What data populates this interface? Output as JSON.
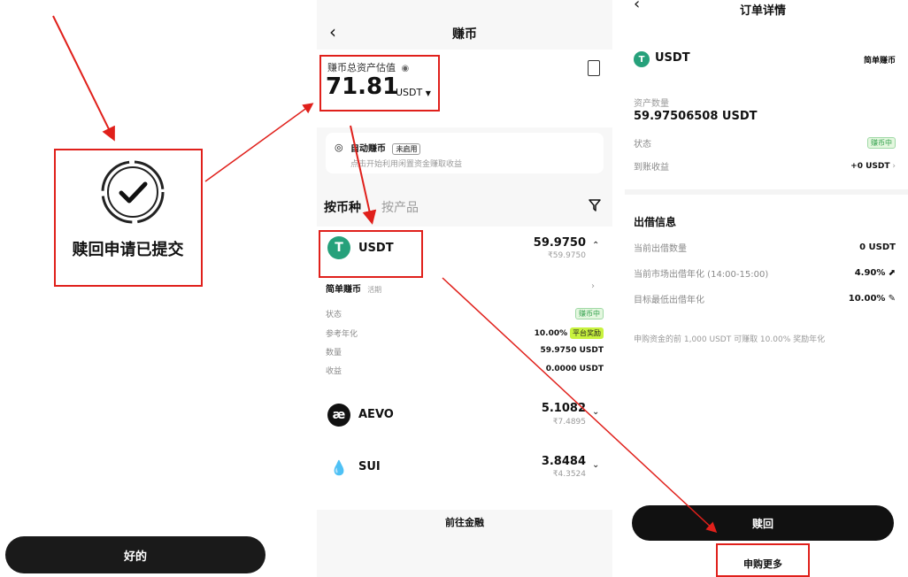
{
  "panel1": {
    "success_text": "赎回申请已提交",
    "ok_button": "好的"
  },
  "panel2": {
    "title": "赚币",
    "asset_label": "赚币总资产估值",
    "asset_value": "71.81",
    "asset_unit": "USDT",
    "auto_earn_label": "自动赚币",
    "auto_earn_tag": "未启用",
    "auto_earn_desc": "点击开始利用闲置资金赚取收益",
    "tabs": [
      "按币种",
      "按产品"
    ],
    "coins": [
      {
        "name": "USDT",
        "amount": "59.9750",
        "sub": "₹59.9750",
        "icon": "tether-icon",
        "color": "#26a17b",
        "glyph": "T"
      },
      {
        "name": "AEVO",
        "amount": "5.1082",
        "sub": "₹7.4895",
        "icon": "aevo-icon",
        "color": "#111111",
        "glyph": "æ"
      },
      {
        "name": "SUI",
        "amount": "3.8484",
        "sub": "₹4.3524",
        "icon": "sui-drop-icon",
        "color": "#4da2ff",
        "glyph": "💧"
      }
    ],
    "product": {
      "name": "简单赚币",
      "type": "活期",
      "rows": [
        {
          "label": "状态",
          "value": "赚币中"
        },
        {
          "label": "参考年化",
          "value": "10.00%",
          "tag": "平台奖励"
        },
        {
          "label": "数量",
          "value": "59.9750 USDT"
        },
        {
          "label": "收益",
          "value": "0.0000 USDT"
        }
      ]
    },
    "footer_link": "前往金融"
  },
  "panel3": {
    "title": "订单详情",
    "coin": "USDT",
    "product_name": "简单赚币",
    "asset_qty_label": "资产数量",
    "asset_qty_value": "59.97506508 USDT",
    "status_label": "状态",
    "status_value": "赚币中",
    "income_label": "到账收益",
    "income_value": "+0 USDT",
    "lending_title": "出借信息",
    "lending_rows": [
      {
        "label": "当前出借数量",
        "value": "0 USDT",
        "icon": ""
      },
      {
        "label": "当前市场出借年化 (14:00-15:00)",
        "value": "4.90%",
        "icon": "trend-chart-icon"
      },
      {
        "label": "目标最低出借年化",
        "value": "10.00%",
        "icon": "edit-icon"
      }
    ],
    "note": "申购资金的前 1,000 USDT 可赚取 10.00% 奖励年化",
    "redeem_button": "赎回",
    "subscribe_more": "申购更多"
  },
  "colors": {
    "annotation_red": "#e0201b",
    "button_black": "#111111",
    "status_green": "#35a24f",
    "reward_lime": "#c8f23e",
    "usdt_green": "#26a17b"
  }
}
